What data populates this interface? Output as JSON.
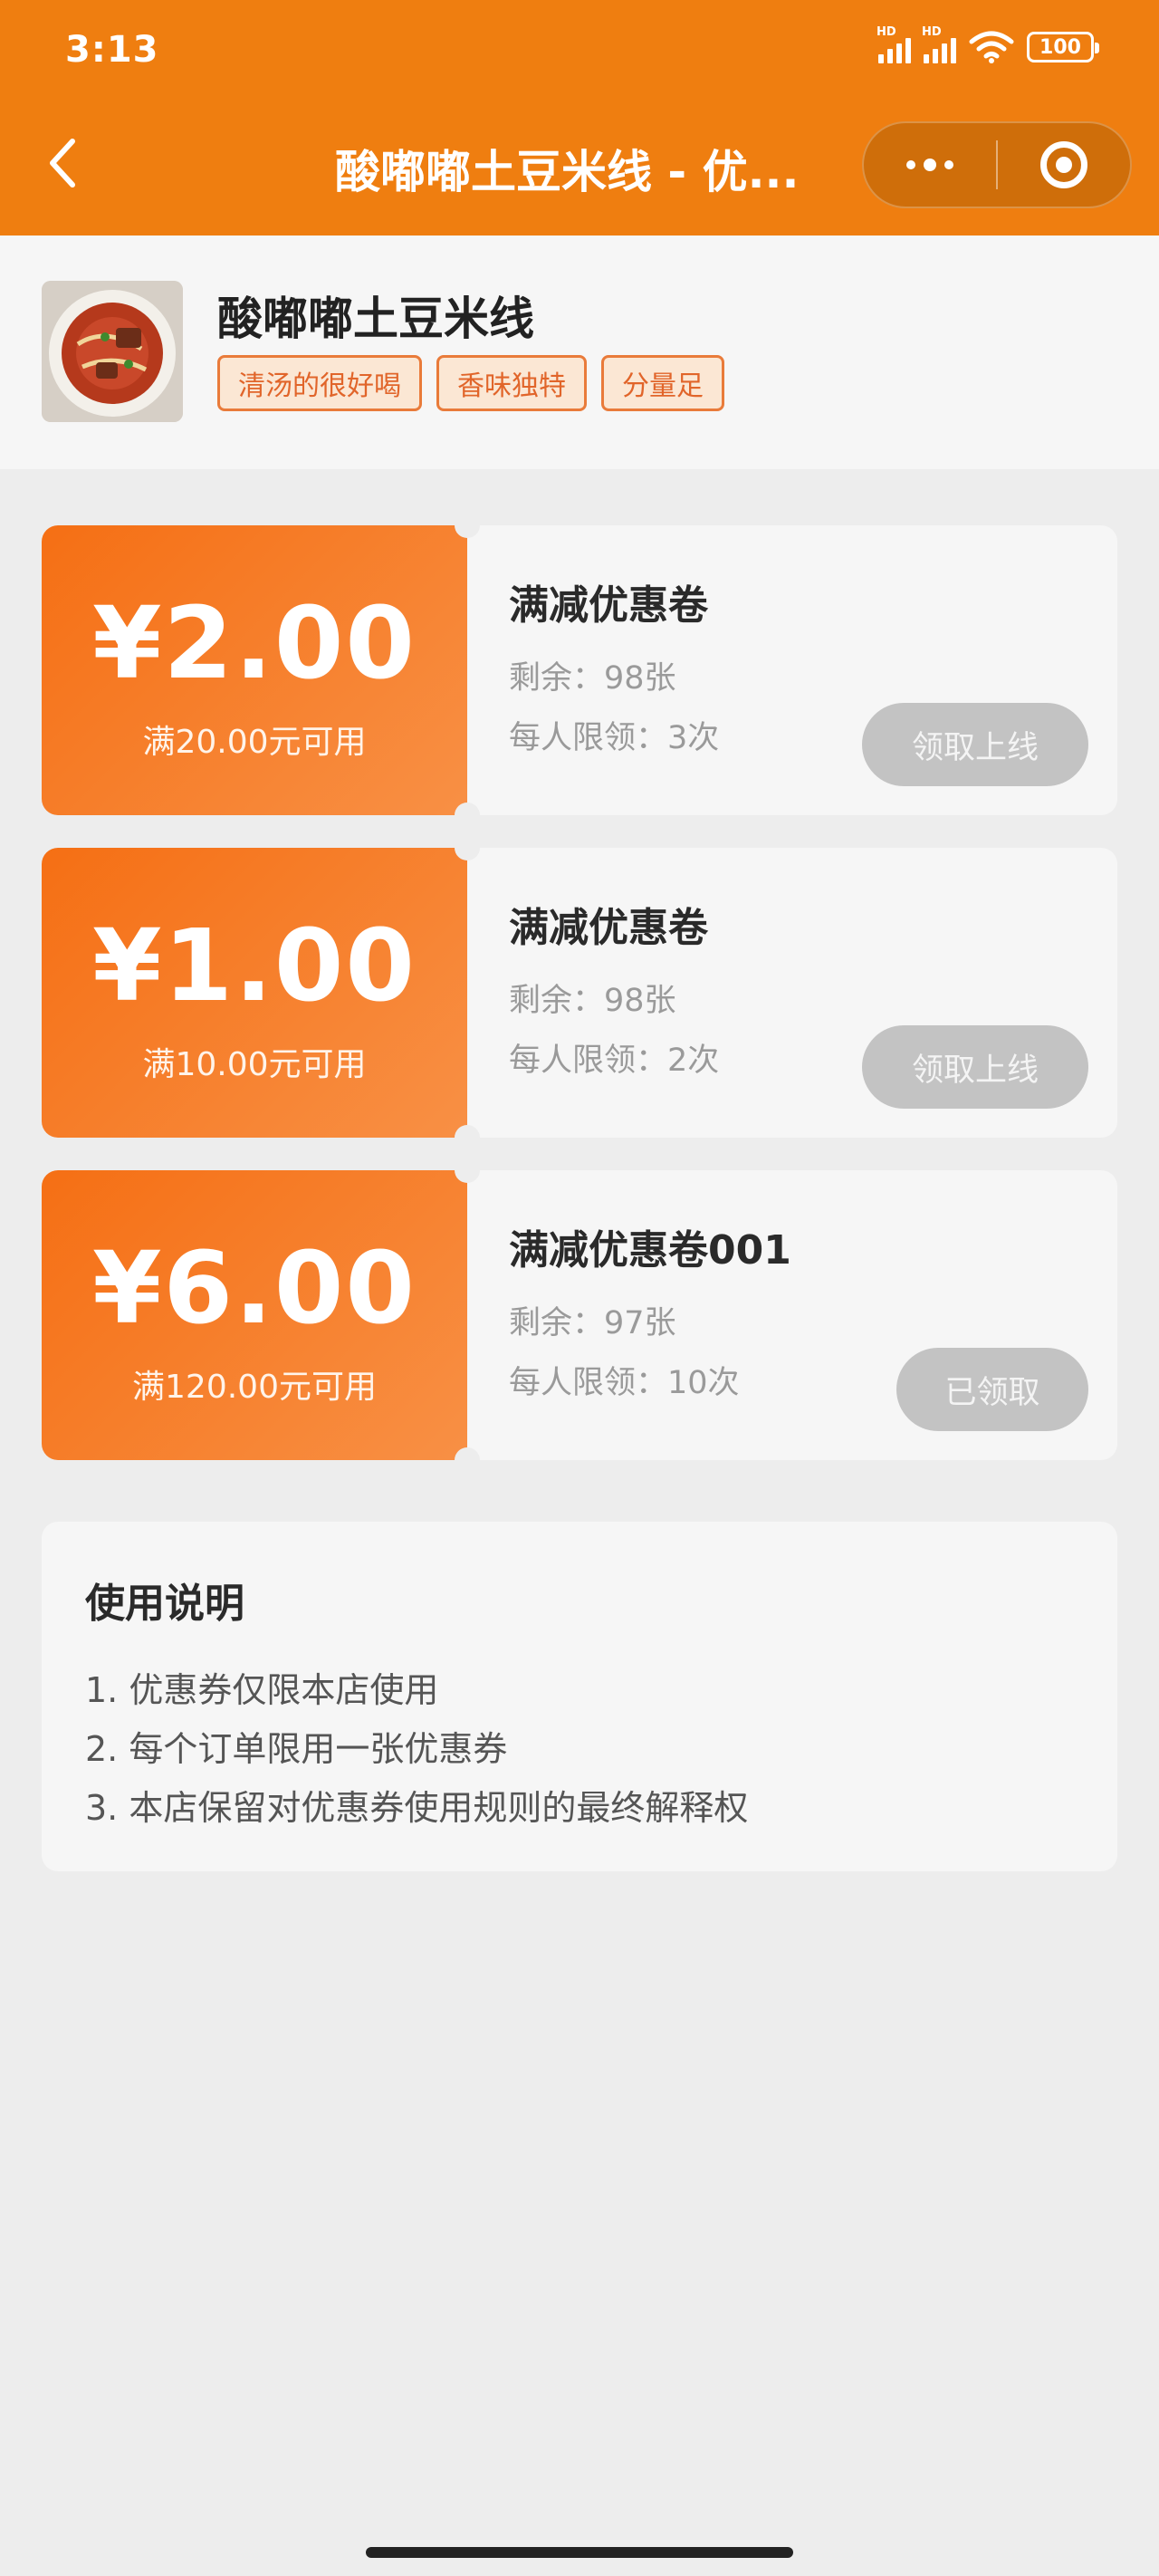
{
  "status_bar": {
    "time": "3:13",
    "hd1": "HD",
    "hd2": "HD",
    "battery": "100"
  },
  "nav": {
    "title": "酸嘟嘟土豆米线 - 优...",
    "accent_color": "#ef7e10"
  },
  "shop": {
    "name": "酸嘟嘟土豆米线",
    "tags": [
      "清汤的很好喝",
      "香味独特",
      "分量足"
    ]
  },
  "coupons": [
    {
      "amount": "¥2.00",
      "condition": "满20.00元可用",
      "title": "满减优惠卷",
      "remaining": "剩余：98张",
      "limit": "每人限领：3次",
      "button": "领取上线"
    },
    {
      "amount": "¥1.00",
      "condition": "满10.00元可用",
      "title": "满减优惠卷",
      "remaining": "剩余：98张",
      "limit": "每人限领：2次",
      "button": "领取上线"
    },
    {
      "amount": "¥6.00",
      "condition": "满120.00元可用",
      "title": "满减优惠卷001",
      "remaining": "剩余：97张",
      "limit": "每人限领：10次",
      "button": "已领取"
    }
  ],
  "usage": {
    "title": "使用说明",
    "items": [
      "1. 优惠券仅限本店使用",
      "2. 每个订单限用一张优惠券",
      "3. 本店保留对优惠券使用规则的最终解释权"
    ]
  }
}
